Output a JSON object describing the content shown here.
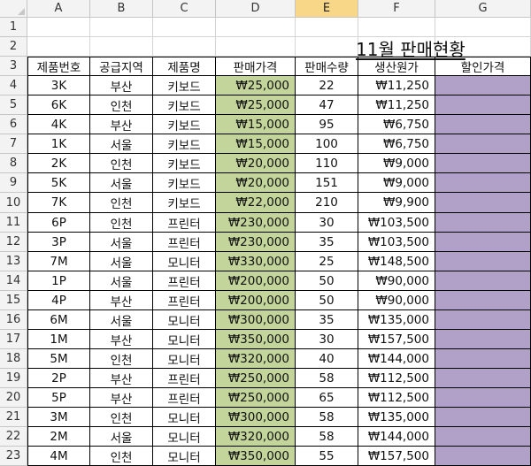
{
  "sheet": {
    "columns": [
      "A",
      "B",
      "C",
      "D",
      "E",
      "F",
      "G"
    ],
    "rows": [
      "1",
      "2",
      "3",
      "4",
      "5",
      "6",
      "7",
      "8",
      "9",
      "10",
      "11",
      "12",
      "13",
      "14",
      "15",
      "16",
      "17",
      "18",
      "19",
      "20",
      "21",
      "22",
      "23"
    ],
    "selected_column": "E",
    "title": "11월 판매현황",
    "headers": [
      "제품번호",
      "공급지역",
      "제품명",
      "판매가격",
      "판매수량",
      "생산원가",
      "할인가격"
    ],
    "records": [
      [
        "3K",
        "부산",
        "키보드",
        "₩25,000",
        "22",
        "₩11,250",
        ""
      ],
      [
        "6K",
        "인천",
        "키보드",
        "₩25,000",
        "47",
        "₩11,250",
        ""
      ],
      [
        "4K",
        "부산",
        "키보드",
        "₩15,000",
        "95",
        "₩6,750",
        ""
      ],
      [
        "1K",
        "서울",
        "키보드",
        "₩15,000",
        "100",
        "₩6,750",
        ""
      ],
      [
        "2K",
        "인천",
        "키보드",
        "₩20,000",
        "110",
        "₩9,000",
        ""
      ],
      [
        "5K",
        "서울",
        "키보드",
        "₩20,000",
        "151",
        "₩9,000",
        ""
      ],
      [
        "7K",
        "인천",
        "키보드",
        "₩22,000",
        "210",
        "₩9,900",
        ""
      ],
      [
        "6P",
        "인천",
        "프린터",
        "₩230,000",
        "30",
        "₩103,500",
        ""
      ],
      [
        "3P",
        "서울",
        "프린터",
        "₩230,000",
        "35",
        "₩103,500",
        ""
      ],
      [
        "7M",
        "서울",
        "모니터",
        "₩330,000",
        "25",
        "₩148,500",
        ""
      ],
      [
        "1P",
        "서울",
        "프린터",
        "₩200,000",
        "50",
        "₩90,000",
        ""
      ],
      [
        "4P",
        "부산",
        "프린터",
        "₩200,000",
        "50",
        "₩90,000",
        ""
      ],
      [
        "6M",
        "서울",
        "모니터",
        "₩300,000",
        "35",
        "₩135,000",
        ""
      ],
      [
        "1M",
        "부산",
        "모니터",
        "₩350,000",
        "30",
        "₩157,500",
        ""
      ],
      [
        "5M",
        "인천",
        "모니터",
        "₩320,000",
        "40",
        "₩144,000",
        ""
      ],
      [
        "2P",
        "부산",
        "프린터",
        "₩250,000",
        "58",
        "₩112,500",
        ""
      ],
      [
        "5P",
        "부산",
        "프린터",
        "₩250,000",
        "65",
        "₩112,500",
        ""
      ],
      [
        "3M",
        "인천",
        "모니터",
        "₩300,000",
        "58",
        "₩135,000",
        ""
      ],
      [
        "2M",
        "서울",
        "모니터",
        "₩320,000",
        "58",
        "₩144,000",
        ""
      ],
      [
        "4M",
        "인천",
        "모니터",
        "₩350,000",
        "55",
        "₩157,500",
        ""
      ]
    ],
    "colors": {
      "price_fill": "#c3d59b",
      "discount_fill": "#b1a0c7",
      "selected_header": "#f9d789"
    }
  }
}
